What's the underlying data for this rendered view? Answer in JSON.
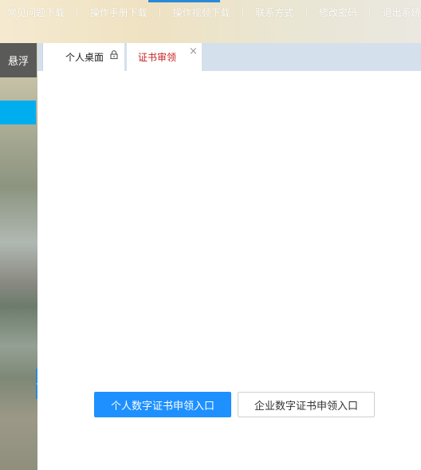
{
  "topnav": {
    "items": [
      "常见问题下载",
      "操作手册下载",
      "操作视频下载",
      "联系方式",
      "修改密码",
      "退出系统"
    ],
    "separator": "|"
  },
  "sidebar": {
    "float_label": "悬浮"
  },
  "tabs": [
    {
      "label": "个人桌面",
      "icon": "lock-icon"
    },
    {
      "label": "证书审领",
      "icon": "close-icon",
      "close_glyph": "×"
    }
  ],
  "main": {
    "personal_button": "个人数字证书申领入口",
    "enterprise_button": "企业数字证书申领入口"
  },
  "colors": {
    "accent_blue": "#1e90ff",
    "active_tab_text": "#c82020",
    "sidebar_active": "#00aef0",
    "tabstrip_bg": "#d4e0ec"
  }
}
